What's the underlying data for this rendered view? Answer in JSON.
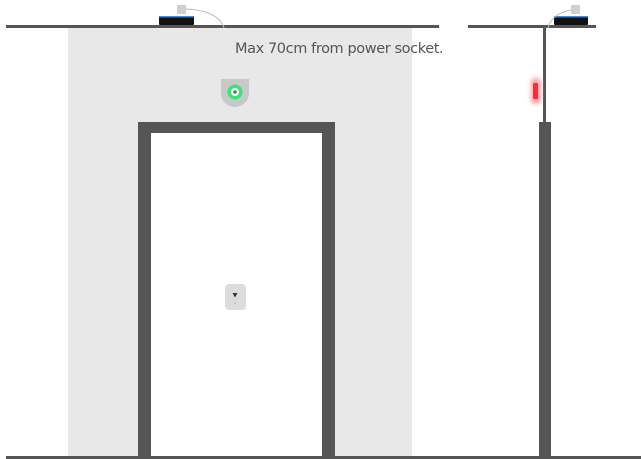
{
  "annotation": {
    "power_socket_note": "Max 70cm from power socket."
  },
  "colors": {
    "background": "#ffffff",
    "wall_panel": "#e8e8e8",
    "door_frame": "#555555",
    "door_leaf": "#ffffff",
    "ceiling_line": "#555555",
    "floor_line": "#555555",
    "power_unit_body": "#111111",
    "power_unit_accent": "#4a8ccf",
    "plug": "#cfcfcf",
    "cable": "#bbbbbb",
    "sensor_housing": "#c8c8c8",
    "sensor_ring": "#3ee07a",
    "sensor_core": "#2a8a55",
    "side_led": "#ff2a3a",
    "side_led_glow": "#ff8a94",
    "handle_device": "#dcdcdc",
    "handle_mark": "#333333"
  },
  "icons": {
    "power_unit_front": "power-supply-icon",
    "power_unit_side": "power-supply-icon",
    "plug_front": "plug-icon",
    "plug_side": "plug-icon",
    "motion_sensor": "motion-sensor-icon",
    "side_indicator": "led-indicator-icon",
    "door_handle_unit": "door-handle-sensor-icon"
  }
}
